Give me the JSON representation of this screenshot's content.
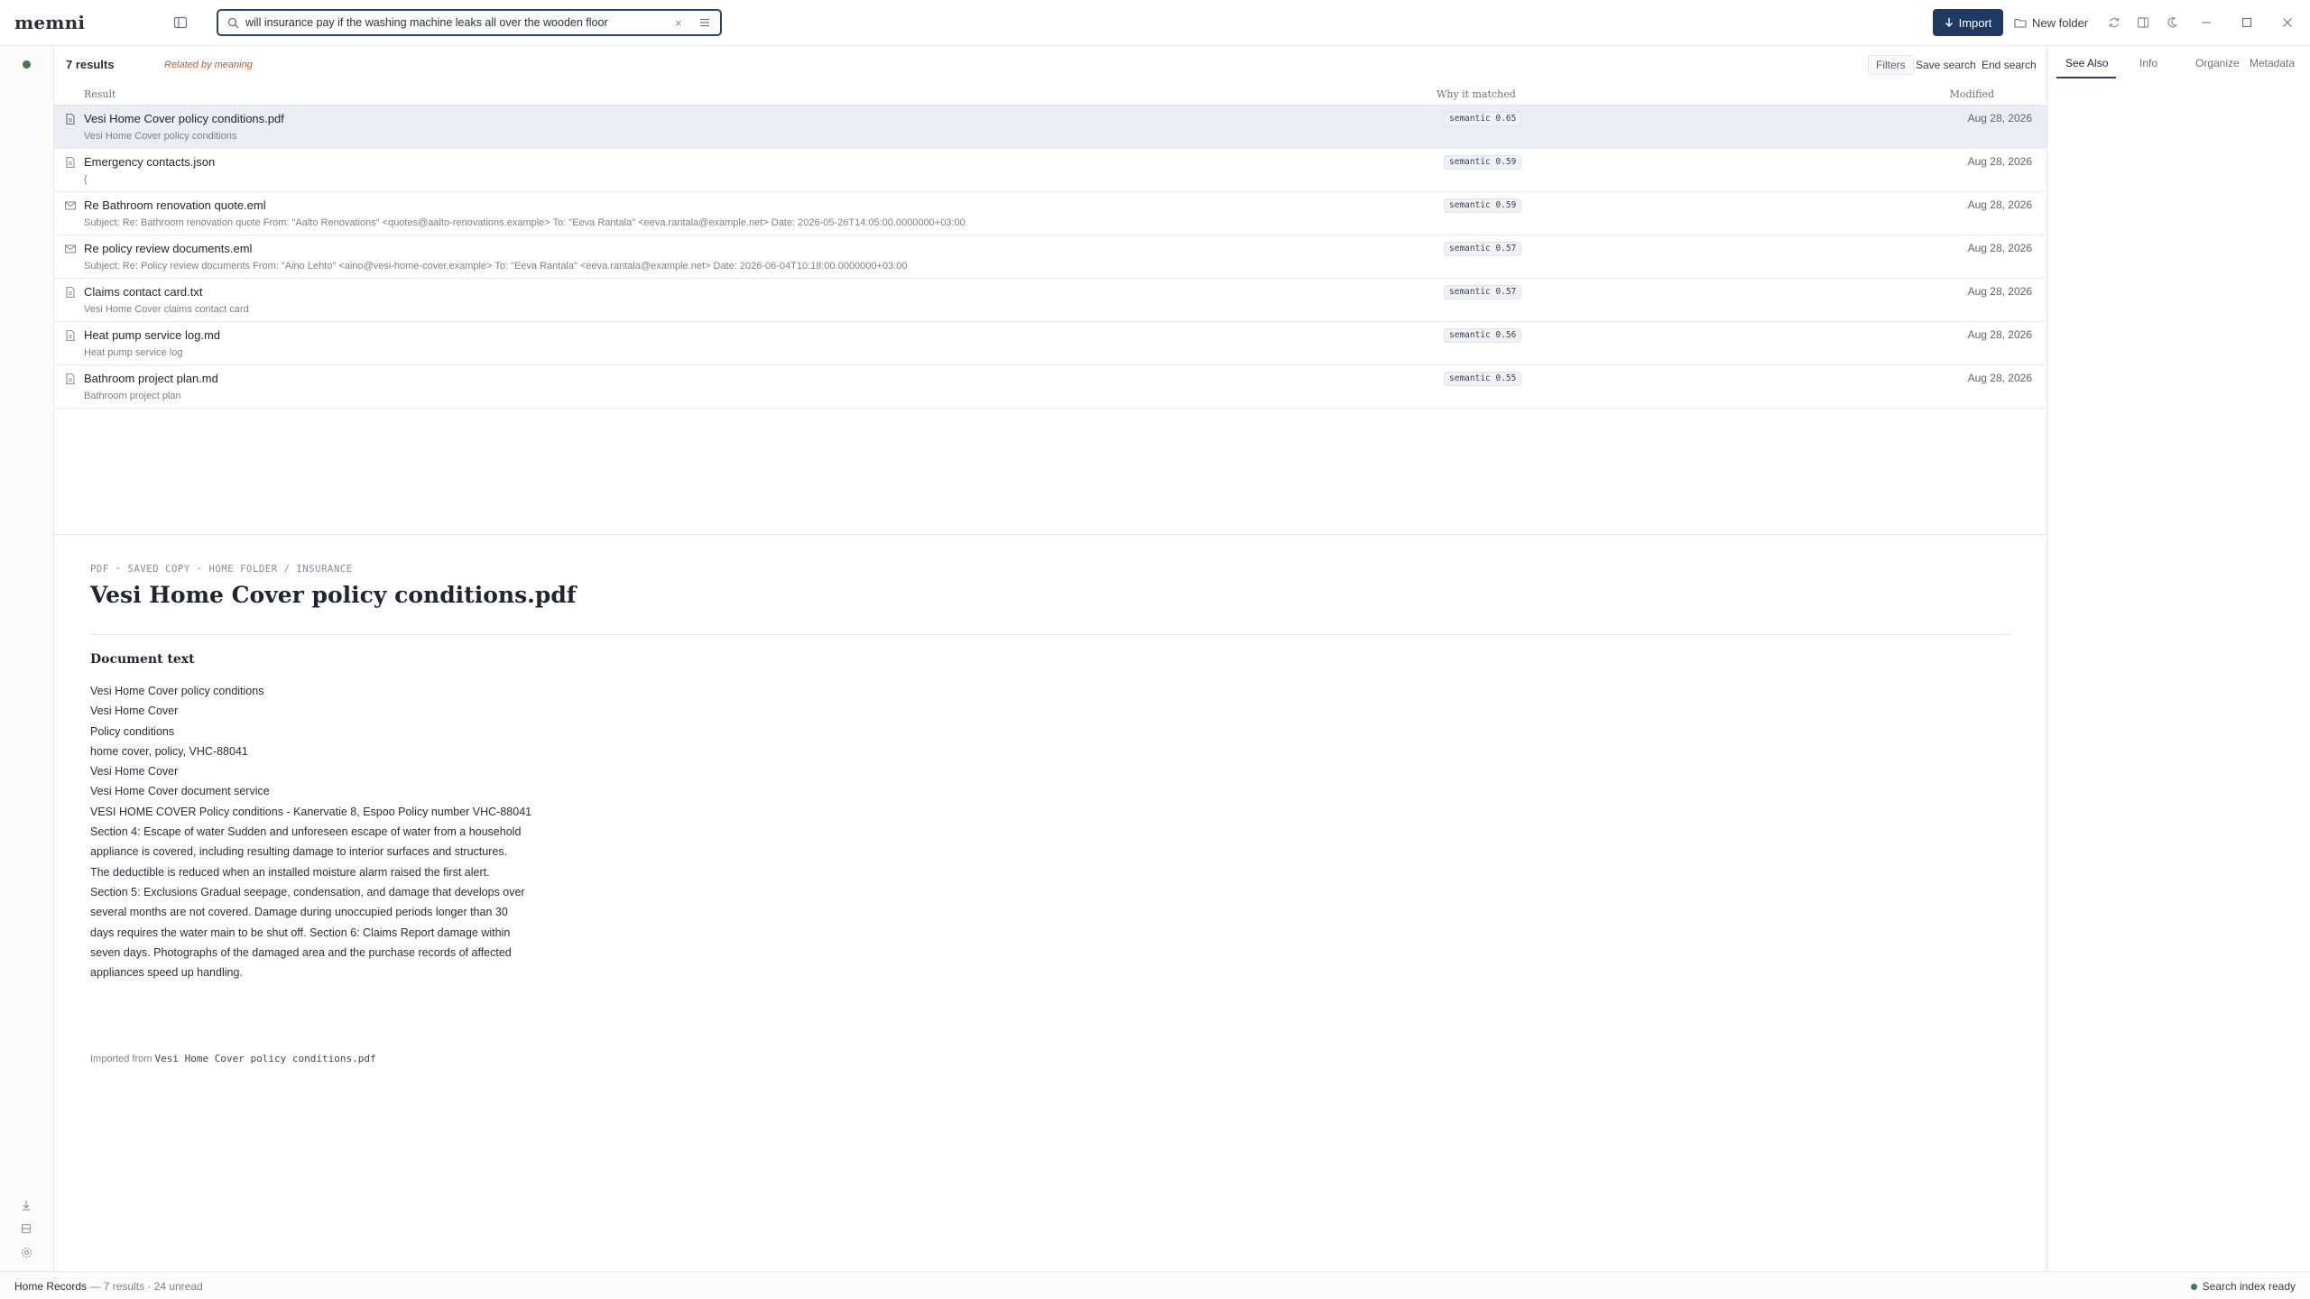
{
  "app": {
    "name": "memni"
  },
  "search": {
    "query": "will insurance pay if the washing machine leaks all over the wooden floor"
  },
  "toolbar": {
    "import_label": "Import",
    "new_folder_label": "New folder"
  },
  "results": {
    "count_label": "7 results",
    "mode_label": "Related by meaning",
    "filters_label": "Filters",
    "save_search_label": "Save search",
    "end_search_label": "End search",
    "columns": {
      "result": "Result",
      "why": "Why it matched",
      "modified": "Modified"
    },
    "rows": [
      {
        "icon": "pdf-file-icon",
        "title": "Vesi Home Cover policy conditions.pdf",
        "snippet": "Vesi Home Cover policy conditions",
        "match": "semantic 0.65",
        "modified": "Aug 28, 2026",
        "selected": true
      },
      {
        "icon": "file-icon",
        "title": "Emergency contacts.json",
        "snippet": "{",
        "match": "semantic 0.59",
        "modified": "Aug 28, 2026",
        "selected": false
      },
      {
        "icon": "mail-icon",
        "title": "Re Bathroom renovation quote.eml",
        "snippet": "Subject: Re: Bathroom renovation quote From: \"Aalto Renovations\" <quotes@aalto-renovations.example> To: \"Eeva Rantala\" <eeva.rantala@example.net> Date: 2026-05-26T14:05:00.0000000+03:00",
        "match": "semantic 0.59",
        "modified": "Aug 28, 2026",
        "selected": false
      },
      {
        "icon": "mail-icon",
        "title": "Re policy review documents.eml",
        "snippet": "Subject: Re: Policy review documents From: \"Aino Lehto\" <aino@vesi-home-cover.example> To: \"Eeva Rantala\" <eeva.rantala@example.net> Date: 2026-06-04T10:18:00.0000000+03:00",
        "match": "semantic 0.57",
        "modified": "Aug 28, 2026",
        "selected": false
      },
      {
        "icon": "file-icon",
        "title": "Claims contact card.txt",
        "snippet": "Vesi Home Cover claims contact card",
        "match": "semantic 0.57",
        "modified": "Aug 28, 2026",
        "selected": false
      },
      {
        "icon": "file-icon",
        "title": "Heat pump service log.md",
        "snippet": "Heat pump service log",
        "match": "semantic 0.56",
        "modified": "Aug 28, 2026",
        "selected": false
      },
      {
        "icon": "file-icon",
        "title": "Bathroom project plan.md",
        "snippet": "Bathroom project plan",
        "match": "semantic 0.55",
        "modified": "Aug 28, 2026",
        "selected": false
      }
    ]
  },
  "preview": {
    "breadcrumb": "PDF · SAVED COPY · HOME FOLDER / INSURANCE",
    "title": "Vesi Home Cover policy conditions.pdf",
    "section_title": "Document text",
    "lines": [
      "Vesi Home Cover policy conditions",
      "Vesi Home Cover",
      "Policy conditions",
      "home cover, policy, VHC-88041",
      "Vesi Home Cover",
      "Vesi Home Cover document service",
      "VESI HOME COVER Policy conditions - Kanervatie 8, Espoo Policy number VHC-88041",
      "Section 4: Escape of water Sudden and unforeseen escape of water from a household",
      "appliance is covered, including resulting damage to interior surfaces and structures.",
      "The deductible is reduced when an installed moisture alarm raised the first alert.",
      "Section 5: Exclusions Gradual seepage, condensation, and damage that develops over",
      "several months are not covered. Damage during unoccupied periods longer than 30",
      "days requires the water main to be shut off. Section 6: Claims Report damage within",
      "seven days. Photographs of the damaged area and the purchase records of affected",
      "appliances speed up handling."
    ],
    "imported_prefix": "Imported from",
    "imported_file": "Vesi Home Cover policy conditions.pdf"
  },
  "right_panel": {
    "tabs": [
      "See Also",
      "Info",
      "Organize",
      "Metadata"
    ],
    "active_tab": "See Also"
  },
  "status": {
    "library": "Home Records",
    "summary": "— 7 results · 24 unread",
    "index": "Search index ready"
  },
  "colors": {
    "accent": "#1f3a62",
    "selected_row": "#e9edf4",
    "tag": "#b5613a",
    "ok": "#3f7a4a"
  }
}
